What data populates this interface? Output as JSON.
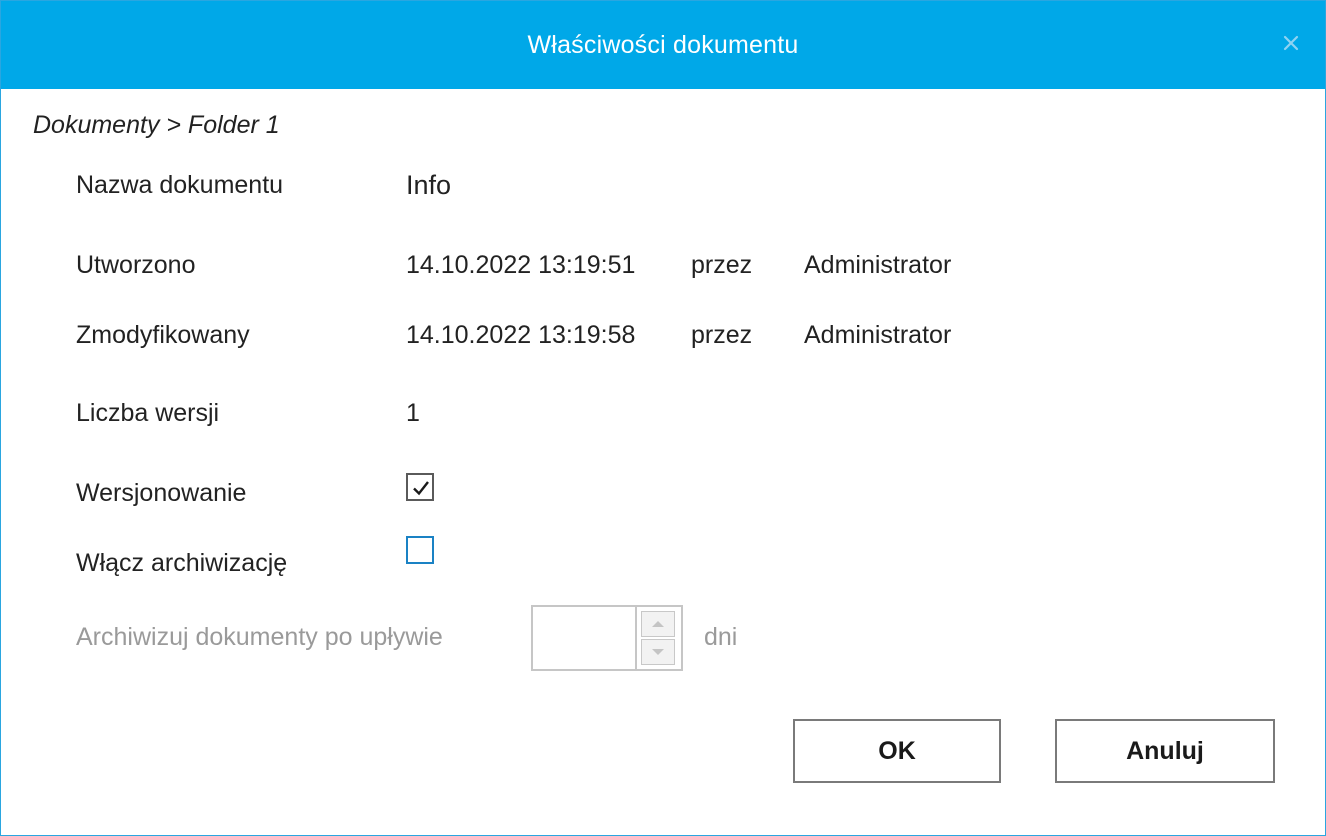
{
  "dialog": {
    "title": "Właściwości dokumentu",
    "close_icon": "close-icon"
  },
  "breadcrumb": "Dokumenty > Folder 1",
  "fields": {
    "name_label": "Nazwa dokumentu",
    "name_value": "Info",
    "created_label": "Utworzono",
    "created_date": "14.10.2022 13:19:51",
    "created_by_word": "przez",
    "created_by": "Administrator",
    "modified_label": "Zmodyfikowany",
    "modified_date": "14.10.2022 13:19:58",
    "modified_by_word": "przez",
    "modified_by": "Administrator",
    "versions_label": "Liczba wersji",
    "versions_value": "1",
    "versioning_label": "Wersjonowanie",
    "versioning_checked": true,
    "archive_label": "Włącz archiwizację",
    "archive_checked": false,
    "archive_after_label": "Archiwizuj dokumenty po upływie",
    "archive_after_value": "",
    "archive_after_unit": "dni"
  },
  "buttons": {
    "ok": "OK",
    "cancel": "Anuluj"
  },
  "colors": {
    "titlebar": "#00a8e8",
    "checkbox_focus": "#1a82c4"
  }
}
